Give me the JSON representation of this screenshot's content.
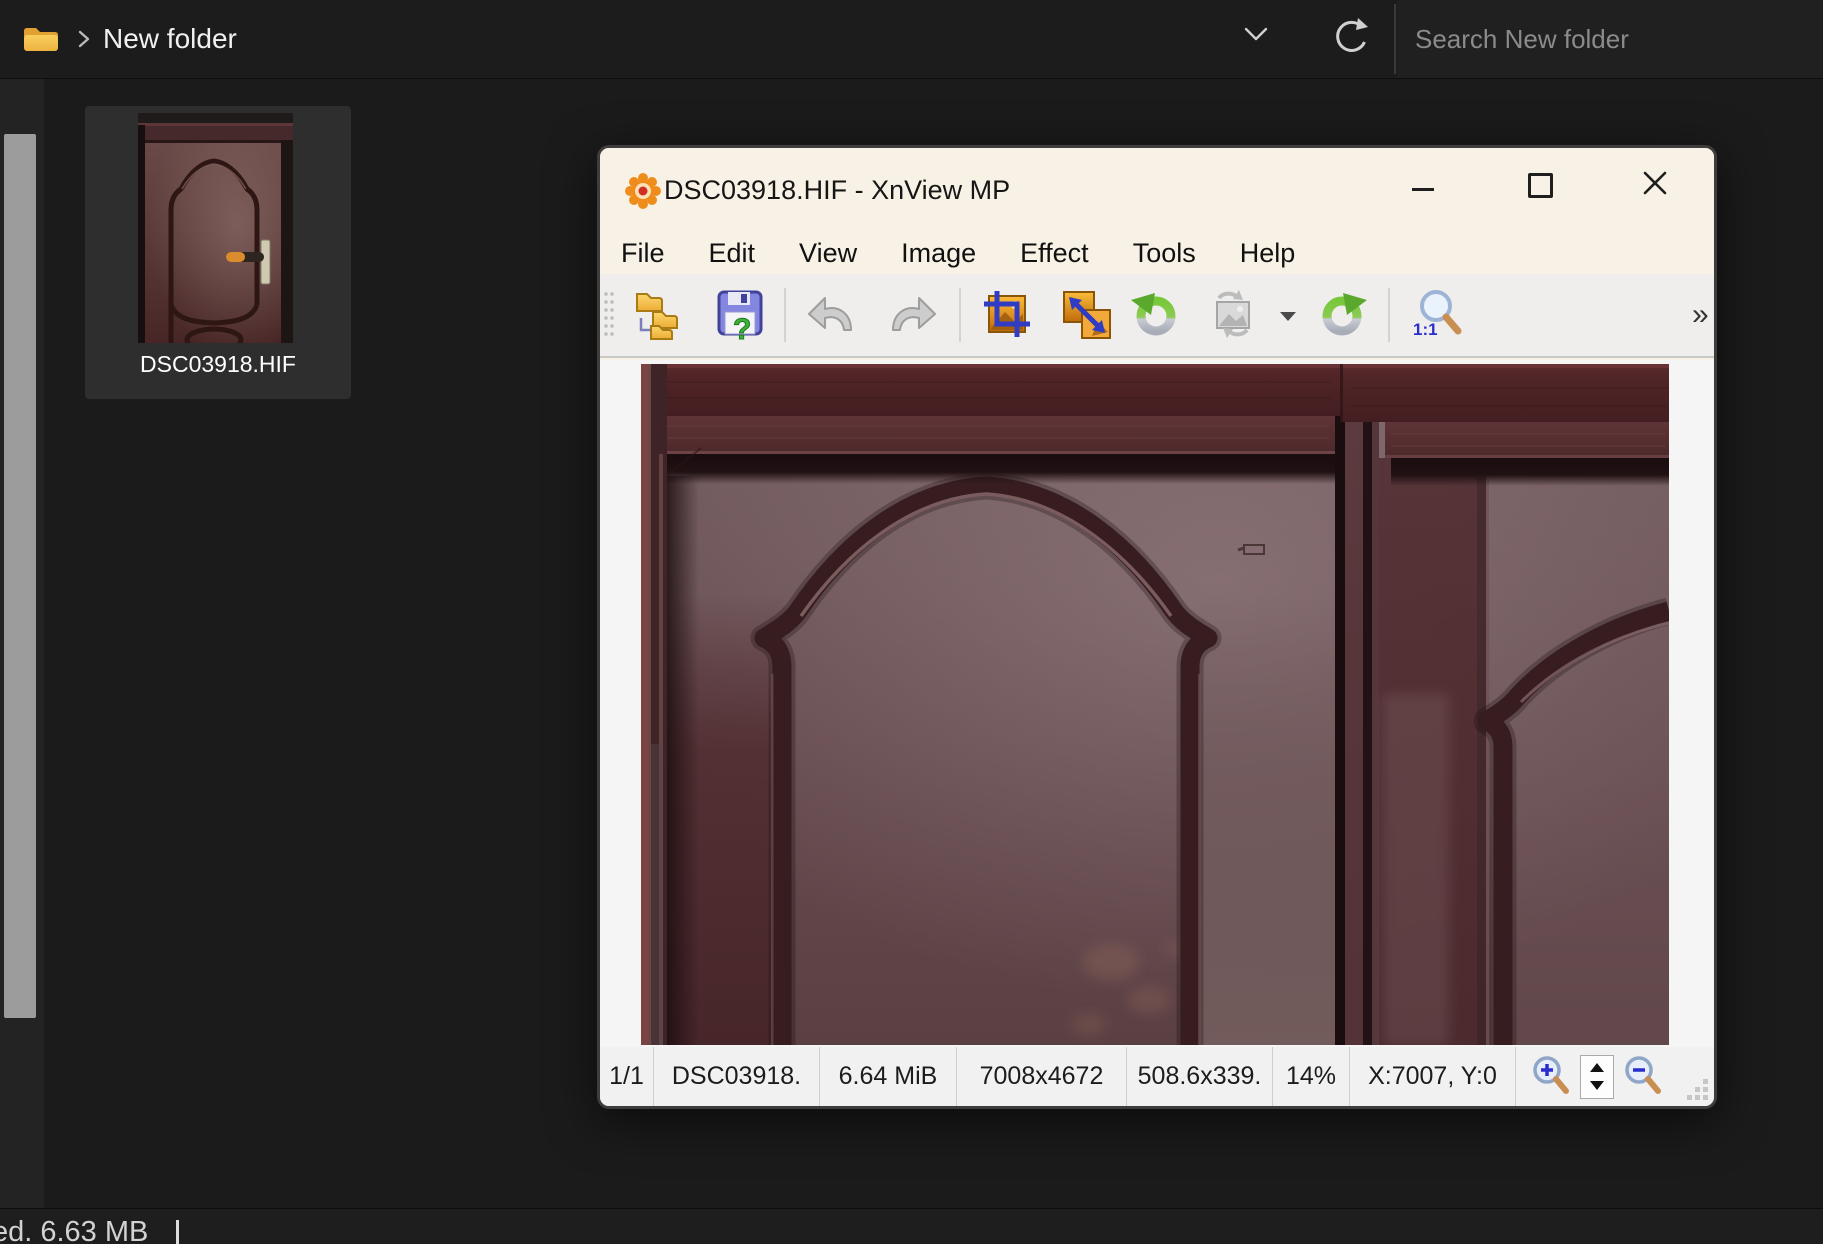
{
  "explorer": {
    "breadcrumb": {
      "folder_label": "New folder"
    },
    "search": {
      "placeholder": "Search New folder"
    },
    "files": [
      {
        "name": "DSC03918.HIF"
      }
    ],
    "statusbar": {
      "text": "ed. 6.63 MB"
    }
  },
  "xnview": {
    "titlebar": {
      "title": "DSC03918.HIF - XnView MP"
    },
    "menu": {
      "items": [
        "File",
        "Edit",
        "View",
        "Image",
        "Effect",
        "Tools",
        "Help"
      ]
    },
    "toolbar": {
      "icons": [
        "browser",
        "save",
        "undo",
        "redo",
        "crop",
        "resize",
        "rotate-left",
        "rotate-custom",
        "rotate-right",
        "zoom-actual"
      ],
      "zoom_actual_label": "1:1",
      "overflow_label": "»"
    },
    "statusbar": {
      "page": "1/1",
      "filename": "DSC03918.",
      "filesize": "6.64 MiB",
      "dimensions": "7008x4672",
      "printsize": "508.6x339.",
      "zoom": "14%",
      "coords": "X:7007, Y:0"
    }
  },
  "colors": {
    "xnview_titlebar": "#f8f1e5",
    "xnview_toolbar": "#efeeec",
    "explorer_bg": "#1b1b1b",
    "folder_yellow": "#f2b53a",
    "door_wood_dark": "#4a2528",
    "door_panel_mauve": "#684e52"
  }
}
